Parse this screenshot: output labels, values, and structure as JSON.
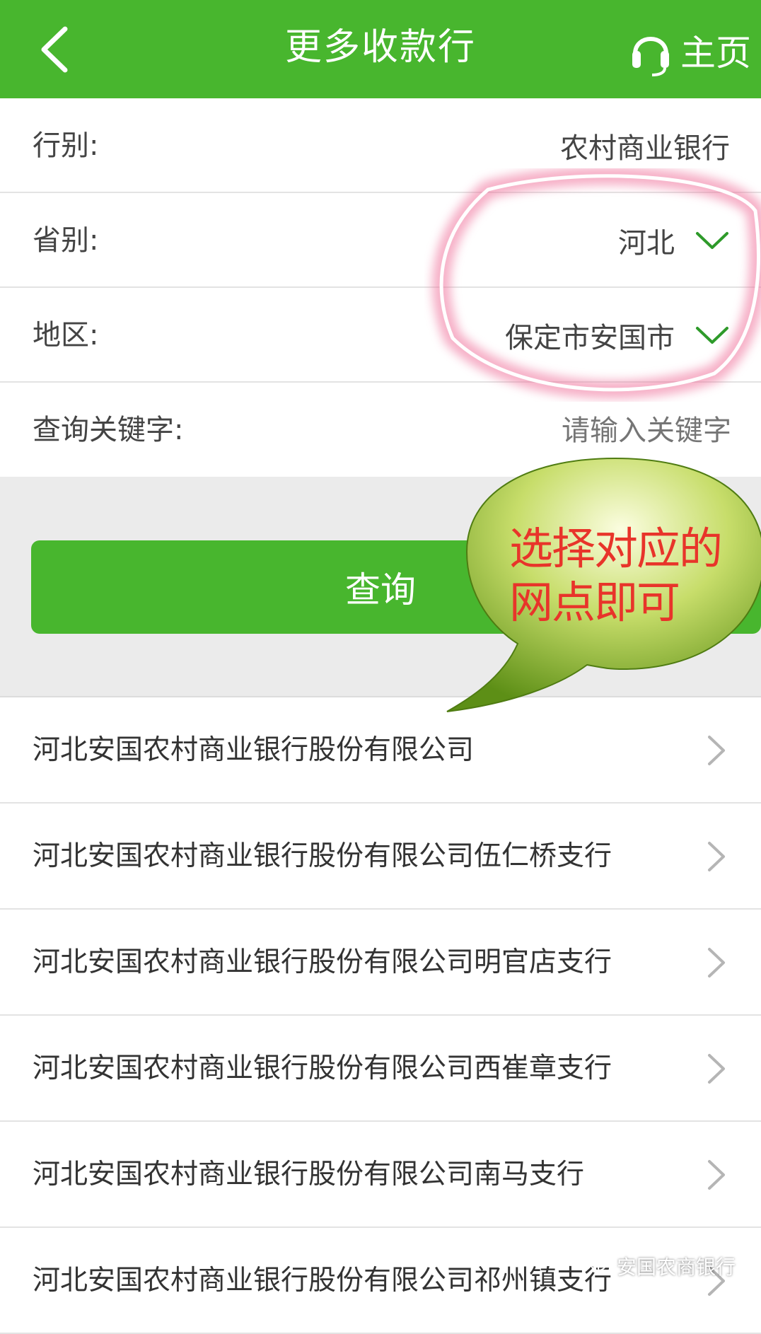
{
  "colors": {
    "brand": "#48b62e",
    "annotation_text": "#e8342a",
    "annotation_circle": "#ef6f9a"
  },
  "header": {
    "title": "更多收款行",
    "back_icon": "chevron-left-icon",
    "home_icon": "headset-icon",
    "home_label": "主页"
  },
  "form": {
    "bank_type": {
      "label": "行别:",
      "value": "农村商业银行"
    },
    "province": {
      "label": "省别:",
      "value": "河北"
    },
    "region": {
      "label": "地区:",
      "value": "保定市安国市"
    },
    "keyword": {
      "label": "查询关键字:",
      "placeholder": "请输入关键字"
    }
  },
  "query_button": {
    "label": "查询"
  },
  "branches": [
    "河北安国农村商业银行股份有限公司",
    "河北安国农村商业银行股份有限公司伍仁桥支行",
    "河北安国农村商业银行股份有限公司明官店支行",
    "河北安国农村商业银行股份有限公司西崔章支行",
    "河北安国农村商业银行股份有限公司南马支行",
    "河北安国农村商业银行股份有限公司祁州镇支行"
  ],
  "annotation": {
    "bubble_text_line1": "选择对应的",
    "bubble_text_line2": "网点即可"
  },
  "watermark": {
    "text": "安国农商银行"
  }
}
